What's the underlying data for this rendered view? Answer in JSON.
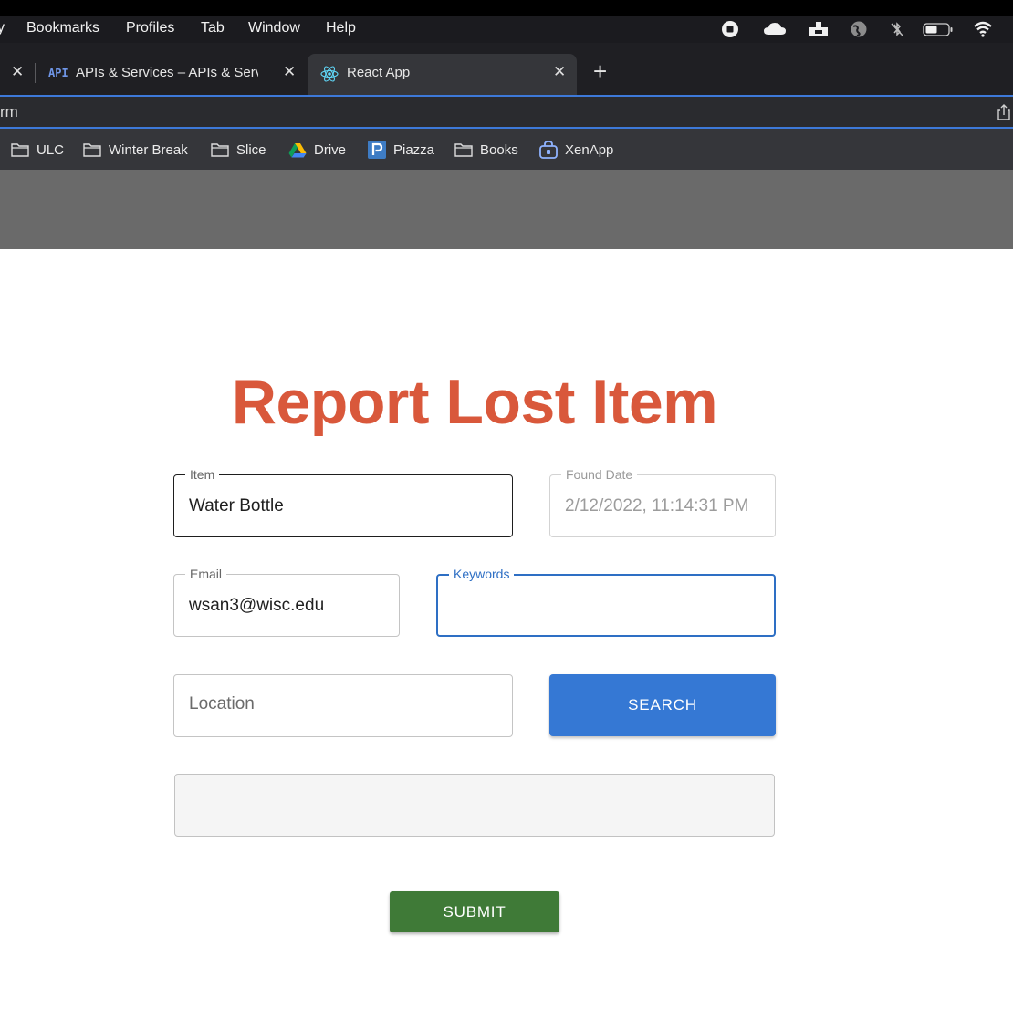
{
  "menubar": {
    "partial_left": "y",
    "items": [
      "Bookmarks",
      "Profiles",
      "Tab",
      "Window",
      "Help"
    ],
    "status_icons": [
      "record-icon",
      "cloud-icon",
      "menu-extra-icon",
      "globe-icon",
      "bluetooth-off-icon",
      "battery-icon",
      "wifi-icon"
    ]
  },
  "tabs": {
    "tab_api": {
      "badge": "API",
      "title": "APIs & Services – APIs & Servic"
    },
    "tab_react": {
      "title": "React App"
    },
    "close_glyph": "✕",
    "new_tab_glyph": "+"
  },
  "address": {
    "url_fragment": "rm"
  },
  "bookmarks": [
    "ULC",
    "Winter Break",
    "Slice",
    "Drive",
    "Piazza",
    "Books",
    "XenApp"
  ],
  "page": {
    "title": "Report Lost Item",
    "form": {
      "item": {
        "label": "Item",
        "value": "Water Bottle"
      },
      "found_date": {
        "label": "Found Date",
        "value": "2/12/2022, 11:14:31 PM"
      },
      "email": {
        "label": "Email",
        "value": "wsan3@wisc.edu"
      },
      "keywords": {
        "label": "Keywords",
        "value": ""
      },
      "location": {
        "placeholder": "Location"
      },
      "search_label": "SEARCH",
      "submit_label": "SUBMIT"
    }
  },
  "colors": {
    "title": "#d9583b",
    "search_button": "#3578d4",
    "submit_button": "#3f7a37",
    "focus_outline": "#2e6fc4"
  }
}
